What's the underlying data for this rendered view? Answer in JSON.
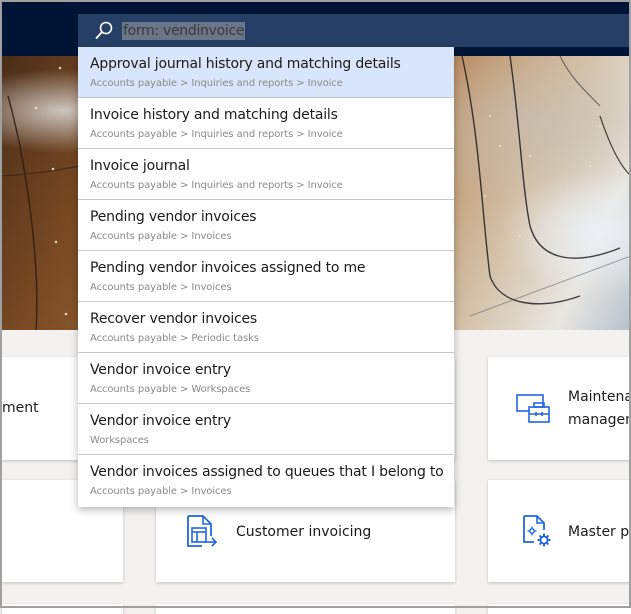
{
  "search": {
    "icon": "search-icon",
    "query": "form: vendinvoice"
  },
  "results": [
    {
      "title": "Approval journal history and matching details",
      "path": "Accounts payable > Inquiries and reports > Invoice",
      "selected": true
    },
    {
      "title": "Invoice history and matching details",
      "path": "Accounts payable > Inquiries and reports > Invoice",
      "selected": false
    },
    {
      "title": "Invoice journal",
      "path": "Accounts payable > Inquiries and reports > Invoice",
      "selected": false
    },
    {
      "title": "Pending vendor invoices",
      "path": "Accounts payable > Invoices",
      "selected": false
    },
    {
      "title": "Pending vendor invoices assigned to me",
      "path": "Accounts payable > Invoices",
      "selected": false
    },
    {
      "title": "Recover vendor invoices",
      "path": "Accounts payable > Periodic tasks",
      "selected": false
    },
    {
      "title": "Vendor invoice entry",
      "path": "Accounts payable > Workspaces",
      "selected": false
    },
    {
      "title": "Vendor invoice entry",
      "path": "Workspaces",
      "selected": false
    },
    {
      "title": "Vendor invoices assigned to queues that I belong to",
      "path": "Accounts payable > Invoices",
      "selected": false
    }
  ],
  "tiles": {
    "left_top": {
      "label": "ment"
    },
    "right_top": {
      "label_line1": "Maintena",
      "label_line2": "managem",
      "icon": "maintenance-toolbox-icon"
    },
    "middle_bottom": {
      "label": "Customer invoicing",
      "icon": "customer-invoicing-icon"
    },
    "right_bottom": {
      "label": "Master p",
      "icon": "master-planning-icon"
    }
  },
  "colors": {
    "navbar": "#001535",
    "search_box": "#253f66",
    "selected_result": "#d9e5fa",
    "icon_accent": "#2266e3"
  }
}
